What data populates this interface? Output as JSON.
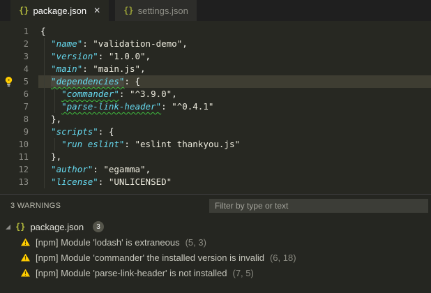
{
  "tabs": [
    {
      "icon": "json-braces",
      "label": "package.json",
      "close_icon": "✕",
      "active": true
    },
    {
      "icon": "json-braces",
      "label": "settings.json",
      "active": false
    }
  ],
  "icons": {
    "json_braces": "{}",
    "tab_close": "✕",
    "warning_bang": "!"
  },
  "editor": {
    "current_line": 5,
    "lines": [
      {
        "num": "1",
        "tokens": [
          {
            "t": "punc",
            "v": "{"
          }
        ]
      },
      {
        "num": "2",
        "tokens": [
          {
            "t": "punc",
            "v": "  "
          },
          {
            "t": "key",
            "v": "\"name\""
          },
          {
            "t": "punc",
            "v": ": "
          },
          {
            "t": "str",
            "v": "\"validation-demo\""
          },
          {
            "t": "punc",
            "v": ","
          }
        ]
      },
      {
        "num": "3",
        "tokens": [
          {
            "t": "punc",
            "v": "  "
          },
          {
            "t": "key",
            "v": "\"version\""
          },
          {
            "t": "punc",
            "v": ": "
          },
          {
            "t": "str",
            "v": "\"1.0.0\""
          },
          {
            "t": "punc",
            "v": ","
          }
        ]
      },
      {
        "num": "4",
        "tokens": [
          {
            "t": "punc",
            "v": "  "
          },
          {
            "t": "key",
            "v": "\"main\""
          },
          {
            "t": "punc",
            "v": ": "
          },
          {
            "t": "str",
            "v": "\"main.js\""
          },
          {
            "t": "punc",
            "v": ","
          }
        ]
      },
      {
        "num": "5",
        "tokens": [
          {
            "t": "punc",
            "v": "  "
          },
          {
            "t": "key",
            "v": "\"dependencies\"",
            "squiggle": true,
            "selected": true
          },
          {
            "t": "punc",
            "v": ": {"
          }
        ]
      },
      {
        "num": "6",
        "tokens": [
          {
            "t": "punc",
            "v": "    "
          },
          {
            "t": "key",
            "v": "\"commander\"",
            "squiggle": true
          },
          {
            "t": "punc",
            "v": ": "
          },
          {
            "t": "str",
            "v": "\"^3.9.0\""
          },
          {
            "t": "punc",
            "v": ","
          }
        ]
      },
      {
        "num": "7",
        "tokens": [
          {
            "t": "punc",
            "v": "    "
          },
          {
            "t": "key",
            "v": "\"parse-link-header\"",
            "squiggle": true
          },
          {
            "t": "punc",
            "v": ": "
          },
          {
            "t": "str",
            "v": "\"^0.4.1\""
          }
        ]
      },
      {
        "num": "8",
        "tokens": [
          {
            "t": "punc",
            "v": "  },"
          }
        ]
      },
      {
        "num": "9",
        "tokens": [
          {
            "t": "punc",
            "v": "  "
          },
          {
            "t": "key",
            "v": "\"scripts\""
          },
          {
            "t": "punc",
            "v": ": {"
          }
        ]
      },
      {
        "num": "10",
        "tokens": [
          {
            "t": "punc",
            "v": "    "
          },
          {
            "t": "key",
            "v": "\"run eslint\""
          },
          {
            "t": "punc",
            "v": ": "
          },
          {
            "t": "str",
            "v": "\"eslint thankyou.js\""
          }
        ]
      },
      {
        "num": "11",
        "tokens": [
          {
            "t": "punc",
            "v": "  },"
          }
        ]
      },
      {
        "num": "12",
        "tokens": [
          {
            "t": "punc",
            "v": "  "
          },
          {
            "t": "key",
            "v": "\"author\""
          },
          {
            "t": "punc",
            "v": ": "
          },
          {
            "t": "str",
            "v": "\"egamma\""
          },
          {
            "t": "punc",
            "v": ","
          }
        ]
      },
      {
        "num": "13",
        "tokens": [
          {
            "t": "punc",
            "v": "  "
          },
          {
            "t": "key",
            "v": "\"license\""
          },
          {
            "t": "punc",
            "v": ": "
          },
          {
            "t": "str",
            "v": "\"UNLICENSED\""
          }
        ]
      }
    ]
  },
  "problems": {
    "header": "3 WARNINGS",
    "filter_placeholder": "Filter by type or text",
    "file": {
      "icon": "json-braces",
      "label": "package.json",
      "badge": "3"
    },
    "warnings": [
      {
        "message": "[npm] Module 'lodash' is extraneous",
        "position": "(5, 3)"
      },
      {
        "message": "[npm] Module 'commander' the installed version is invalid",
        "position": "(6, 18)"
      },
      {
        "message": "[npm] Module 'parse-link-header' is not installed",
        "position": "(7, 5)"
      }
    ]
  },
  "colors": {
    "editor_bg": "#272822",
    "key_cyan": "#66d9ef",
    "string_cream": "#eceadd",
    "squiggle_green": "#3fbf3f",
    "line_highlight": "#3e3d32",
    "word_selection": "#49483e",
    "warning_yellow": "#ffcc00",
    "json_icon_olive": "#b3ba3d"
  }
}
